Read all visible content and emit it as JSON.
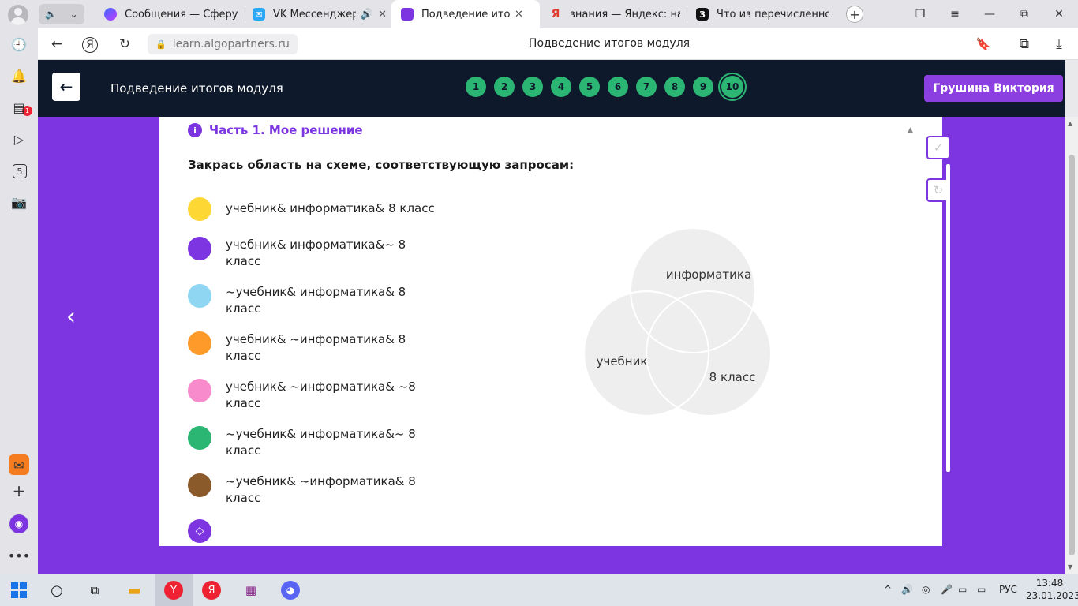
{
  "browser": {
    "tabs": [
      {
        "title": "Сообщения — Сферум",
        "favicon": "sferum-icon",
        "color": "#5a5ae0"
      },
      {
        "title": "VK Мессенджер",
        "favicon": "vk-icon",
        "color": "#2aa7f5"
      },
      {
        "title": "Подведение итогов м",
        "favicon": "algo-icon",
        "color": "#7c35e0"
      },
      {
        "title": "знания — Яндекс: нашл",
        "favicon": "yandex-icon",
        "color": "#e03a2f"
      },
      {
        "title": "Что из перечисленного",
        "favicon": "znanija-icon",
        "color": "#111111"
      }
    ],
    "url": "learn.algopartners.ru",
    "page_title": "Подведение итогов модуля",
    "notification_count": "1"
  },
  "header": {
    "title": "Подведение итогов модуля",
    "steps": [
      "1",
      "2",
      "3",
      "4",
      "5",
      "6",
      "7",
      "8",
      "9",
      "10"
    ],
    "current_step": "10",
    "user_name": "Грушина Виктория"
  },
  "content": {
    "part_title": "Часть 1. Мое решение",
    "task": "Закрась область на схеме, соответствующую запросам:",
    "legend": [
      {
        "text": "учебник& информатика& 8 класс",
        "color": "#fdd835"
      },
      {
        "text": "учебник& информатика&~ 8 класс",
        "color": "#7c35e0"
      },
      {
        "text": "~учебник& информатика& 8 класс",
        "color": "#8fd6f2"
      },
      {
        "text": "учебник& ~информатика& 8 класс",
        "color": "#fd9a2a"
      },
      {
        "text": "учебник& ~информатика& ~8 класс",
        "color": "#f78bcb"
      },
      {
        "text": "~учебник& информатика&~ 8 класс",
        "color": "#2bb673"
      },
      {
        "text": "~учебник& ~информатика& 8 класс",
        "color": "#8b5a2b"
      }
    ],
    "venn_labels": {
      "informatics": "информатика",
      "textbook": "учебник",
      "grade8": "8 класс"
    }
  },
  "taskbar": {
    "lang": "РУС",
    "time": "13:48",
    "date": "23.01.2023"
  }
}
